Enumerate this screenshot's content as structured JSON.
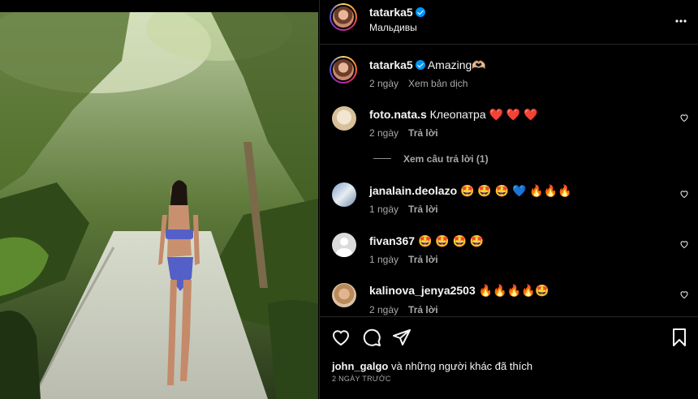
{
  "header": {
    "username": "tatarka5",
    "location": "Мальдивы"
  },
  "caption": {
    "username": "tatarka5",
    "text": "Amazing🫶🏼",
    "age": "2 ngày",
    "translate": "Xem bản dịch"
  },
  "comments": [
    {
      "username": "foto.nata.s",
      "text": "Клеопатра ❤️ ❤️ ❤️",
      "age": "2 ngày",
      "reply": "Trả lời",
      "view_replies": "Xem câu trả lời (1)"
    },
    {
      "username": "janalain.deolazo",
      "text": "🤩 🤩 🤩 💙 🔥🔥🔥",
      "age": "1 ngày",
      "reply": "Trả lời"
    },
    {
      "username": "fivan367",
      "text": "🤩 🤩 🤩 🤩",
      "age": "1 ngày",
      "reply": "Trả lời"
    },
    {
      "username": "kalinova_jenya2503",
      "text": "🔥🔥🔥🔥🤩",
      "age": "2 ngày",
      "reply": "Trả lời"
    }
  ],
  "likes": {
    "user": "john_galgo",
    "rest": " và những người khác đã thích"
  },
  "post_date": "2 NGÀY TRƯỚC",
  "icons": [
    "like-icon",
    "comment-icon",
    "share-icon",
    "save-icon",
    "more-options-icon",
    "verified-icon"
  ]
}
